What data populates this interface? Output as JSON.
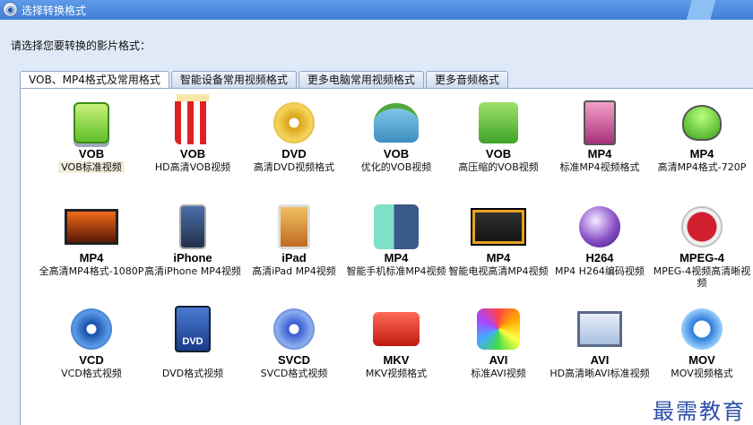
{
  "window": {
    "title": "选择转换格式"
  },
  "prompt": "请选择您要转换的影片格式：",
  "tabs": [
    {
      "label": "VOB、MP4格式及常用格式",
      "active": true
    },
    {
      "label": "智能设备常用视频格式",
      "active": false
    },
    {
      "label": "更多电脑常用视频格式",
      "active": false
    },
    {
      "label": "更多音频格式",
      "active": false
    }
  ],
  "formats": [
    {
      "badge": "VOB",
      "caption": "VOB标准视频",
      "icon": "green-drive-icon",
      "selected": true
    },
    {
      "badge": "VOB",
      "caption": "HD高清VOB视频",
      "icon": "popcorn-icon"
    },
    {
      "badge": "DVD",
      "caption": "高清DVD视频格式",
      "icon": "gold-dvd-disc-icon"
    },
    {
      "badge": "VOB",
      "caption": "优化的VOB视频",
      "icon": "gift-box-icon"
    },
    {
      "badge": "VOB",
      "caption": "高压缩的VOB视频",
      "icon": "green-disc-box-icon"
    },
    {
      "badge": "MP4",
      "caption": "标准MP4视频格式",
      "icon": "mp4-player-icon"
    },
    {
      "badge": "MP4",
      "caption": "高清MP4格式-720P",
      "icon": "green-alien-icon"
    },
    {
      "badge": "MP4",
      "caption": "全高清MP4格式-1080P",
      "icon": "widescreen-tv-icon"
    },
    {
      "badge": "iPhone",
      "caption": "高清iPhone MP4视频",
      "icon": "iphone-icon"
    },
    {
      "badge": "iPad",
      "caption": "高清iPad MP4视频",
      "icon": "ipad-icon"
    },
    {
      "badge": "MP4",
      "caption": "智能手机标准MP4视频",
      "icon": "smartphone-icon"
    },
    {
      "badge": "MP4",
      "caption": "智能电视高清MP4视频",
      "icon": "smart-tv-icon"
    },
    {
      "badge": "H264",
      "caption": "MP4 H264编码视频",
      "icon": "purple-sphere-icon"
    },
    {
      "badge": "MPEG-4",
      "caption": "MPEG-4视频高清晰视频",
      "icon": "film-strip-icon"
    },
    {
      "badge": "VCD",
      "caption": "VCD格式视频",
      "icon": "blue-vcd-disc-icon"
    },
    {
      "badge": "",
      "caption": "DVD格式视频",
      "icon": "dvd-case-icon",
      "icon_text": "DVD"
    },
    {
      "badge": "SVCD",
      "caption": "SVCD格式视频",
      "icon": "svcd-disc-icon"
    },
    {
      "badge": "MKV",
      "caption": "MKV视频格式",
      "icon": "red-play-icon"
    },
    {
      "badge": "AVI",
      "caption": "标准AVI视频",
      "icon": "photos-icon"
    },
    {
      "badge": "AVI",
      "caption": "HD高清晰AVI标准视频",
      "icon": "monitor-icon"
    },
    {
      "badge": "MOV",
      "caption": "MOV视频格式",
      "icon": "quicktime-icon"
    }
  ],
  "watermark": "最需教育"
}
